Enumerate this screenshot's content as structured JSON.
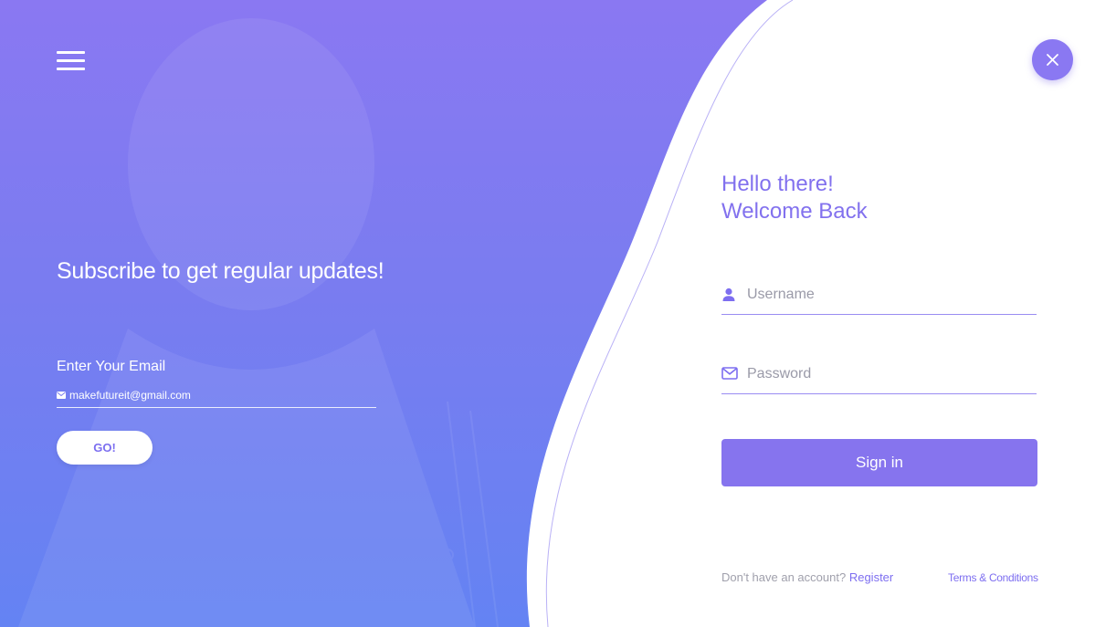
{
  "left_panel": {
    "subscribe_title": "Subscribe to get regular updates!",
    "email_label": "Enter Your Email",
    "email_value": "makefutureit@gmail.com",
    "go_label": "GO!"
  },
  "login": {
    "greeting_line1": "Hello there!",
    "greeting_line2": "Welcome Back",
    "username_placeholder": "Username",
    "password_placeholder": "Password",
    "signin_label": "Sign in",
    "no_account_text": "Don't have an account?",
    "register_label": "Register",
    "terms_label": "Terms & Conditions"
  },
  "icons": {
    "menu": "hamburger-menu-icon",
    "close": "close-icon",
    "user": "user-icon",
    "mail": "mail-icon"
  },
  "colors": {
    "accent": "#8674ee",
    "gradient_top": "#8a78f2",
    "gradient_bottom": "#6483f3",
    "white": "#ffffff"
  }
}
